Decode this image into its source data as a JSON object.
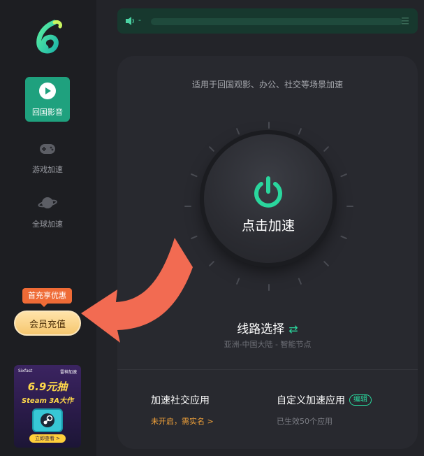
{
  "sidebar": {
    "logo": "leaf-logo-icon",
    "items": [
      {
        "label": "回国影音",
        "icon": "play-circle-icon",
        "active": true
      },
      {
        "label": "游戏加速",
        "icon": "gamepad-icon",
        "active": false
      },
      {
        "label": "全球加速",
        "icon": "planet-icon",
        "active": false
      }
    ],
    "vip": {
      "badge": "首充享优惠",
      "button": "会员充值"
    },
    "promo": {
      "brand_left": "Sixfast",
      "brand_right": "雷神加速",
      "price": "6.9元抽",
      "subtitle": "Steam 3A大作",
      "cta": "立即查看 >"
    }
  },
  "topbar": {
    "text": "-"
  },
  "main": {
    "subtitle": "适用于回国观影、办公、社交等场景加速",
    "power_label": "点击加速",
    "route": {
      "title": "线路选择",
      "swap_icon": "⇄",
      "detail": "亚洲-中国大陆 - 智能节点"
    },
    "social": {
      "title": "加速社交应用",
      "status": "未开启，需实名 >"
    },
    "custom": {
      "title": "自定义加速应用",
      "edit": "编辑",
      "status": "已生效50个应用"
    }
  },
  "colors": {
    "accent": "#2ad69d",
    "sidebar_active": "#1fa17e",
    "warning": "#f2a23a",
    "annotation_arrow": "#f26b52"
  }
}
